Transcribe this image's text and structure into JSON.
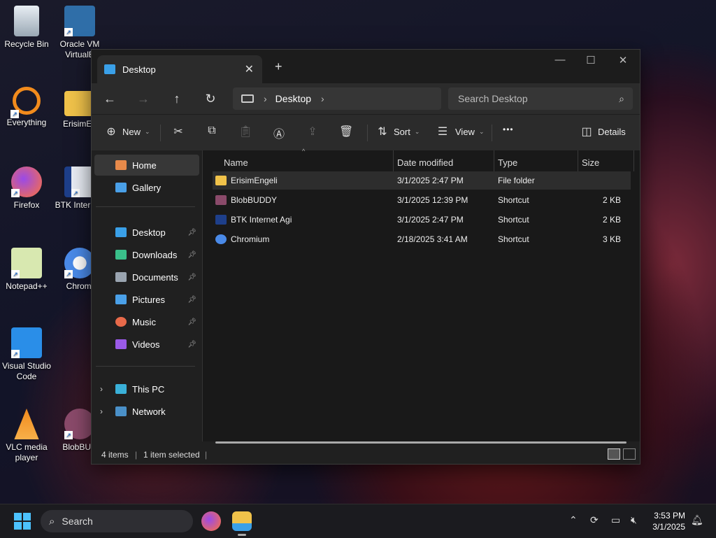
{
  "desktop_icons": [
    {
      "label": "Recycle Bin",
      "icon": "recycle-bin-icon",
      "color": "#cfd8e0"
    },
    {
      "label": "Oracle VM VirtualB",
      "icon": "virtualbox-icon",
      "color": "#2f6ea8"
    },
    {
      "label": "Everything",
      "icon": "everything-icon",
      "color": "#f28b1c"
    },
    {
      "label": "ErisimEn",
      "icon": "folder-icon",
      "color": "#f0c24a"
    },
    {
      "label": "Firefox",
      "icon": "firefox-icon",
      "color": "#ff7139"
    },
    {
      "label": "BTK Inter Agi",
      "icon": "btk-icon",
      "color": "#1e3f8a"
    },
    {
      "label": "Notepad++",
      "icon": "notepadpp-icon",
      "color": "#8fc24a"
    },
    {
      "label": "Chromi",
      "icon": "chromium-icon",
      "color": "#4a8ae8"
    },
    {
      "label": "Visual Studio Code",
      "icon": "vscode-icon",
      "color": "#2a8ee8"
    },
    {
      "label": "VLC media player",
      "icon": "vlc-icon",
      "color": "#f08a1c"
    },
    {
      "label": "BlobBUD",
      "icon": "blobbuddy-icon",
      "color": "#8a4a6a"
    }
  ],
  "window": {
    "tab_title": "Desktop",
    "new_tab": "+",
    "close_tab": "✕",
    "minimize": "—",
    "maximize": "☐",
    "close": "✕"
  },
  "nav": {
    "back": "←",
    "forward": "→",
    "up": "↑",
    "refresh": "↻",
    "breadcrumb": "Desktop",
    "search_placeholder": "Search Desktop"
  },
  "toolbar": {
    "new_label": "New",
    "sort_label": "Sort",
    "view_label": "View",
    "more": "•••",
    "details_label": "Details"
  },
  "sidebar": {
    "home": "Home",
    "gallery": "Gallery",
    "quick": [
      {
        "label": "Desktop",
        "color": "#3aa0e8"
      },
      {
        "label": "Downloads",
        "color": "#3ac08a"
      },
      {
        "label": "Documents",
        "color": "#9aa4b0"
      },
      {
        "label": "Pictures",
        "color": "#4aa0e8"
      },
      {
        "label": "Music",
        "color": "#e86a4a"
      },
      {
        "label": "Videos",
        "color": "#9a5ae8"
      }
    ],
    "this_pc": "This PC",
    "network": "Network"
  },
  "columns": {
    "name": "Name",
    "date": "Date modified",
    "type": "Type",
    "size": "Size"
  },
  "files": [
    {
      "name": "ErisimEngeli",
      "date": "3/1/2025 2:47 PM",
      "type": "File folder",
      "size": "",
      "color": "#f0c24a"
    },
    {
      "name": "BlobBUDDY",
      "date": "3/1/2025 12:39 PM",
      "type": "Shortcut",
      "size": "2 KB",
      "color": "#8a4a6a"
    },
    {
      "name": "BTK Internet Agi",
      "date": "3/1/2025 2:47 PM",
      "type": "Shortcut",
      "size": "2 KB",
      "color": "#1e3f8a"
    },
    {
      "name": "Chromium",
      "date": "2/18/2025 3:41 AM",
      "type": "Shortcut",
      "size": "3 KB",
      "color": "#4a8ae8"
    }
  ],
  "status": {
    "items": "4 items",
    "selected": "1 item selected"
  },
  "taskbar": {
    "search": "Search",
    "time": "3:53 PM",
    "date": "3/1/2025"
  }
}
